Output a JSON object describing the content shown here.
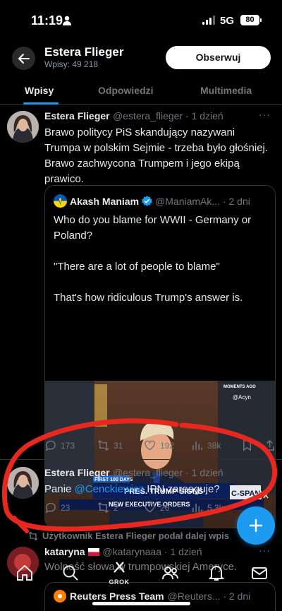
{
  "status_bar": {
    "time": "11:19",
    "network": "5G",
    "battery": "80"
  },
  "profile_header": {
    "name": "Estera Flieger",
    "post_count": "Wpisy: 49 218",
    "follow_label": "Obserwuj"
  },
  "tabs": [
    {
      "label": "Wpisy",
      "active": true
    },
    {
      "label": "Odpowiedzi",
      "active": false
    },
    {
      "label": "Multimedia",
      "active": false
    }
  ],
  "tweets": [
    {
      "name": "Estera Flieger",
      "handle": "@estera_flieger · 1 dzień",
      "text": "Brawo politycy PiS skandujący nazywani Trumpa w polskim Sejmie - trzeba było głośniej. Brawo zachwycona Trumpem i jego ekipą prawico.",
      "quote": {
        "name": "Akash Maniam",
        "handle": "@ManiamAk... · 2 dni",
        "paragraphs": [
          "Who do you blame for WWII - Germany or Poland?",
          "\"There are a lot of people to blame\"",
          "That's how ridiculous Trump's answer is."
        ],
        "media": {
          "badge": "MOMENTS AGO",
          "watermark": "@Acyn",
          "banner_tag": "FIRST 100 DAYS",
          "banner_text": "PRES. TRUMP SIGNS",
          "banner_text_2": "NEW EXECUTIVE ORDERS",
          "channel": "C-SPAN"
        }
      },
      "actions": {
        "replies": "173",
        "retweets": "31",
        "likes": "192",
        "views": "38k"
      }
    },
    {
      "name": "Estera Flieger",
      "handle": "@estera_flieger · 1 dzień",
      "text_prefix": "Panie ",
      "mention": "@Cenckiewicz",
      "text_suffix": " IPN zareaguje?",
      "actions": {
        "replies": "23",
        "retweets": "2",
        "likes": "26",
        "views": "5,3k"
      }
    },
    {
      "retweet_context": "Użytkownik Estera Flieger podał dalej wpis",
      "name": "kataryna",
      "handle": "@katarynaaa · 1 dzień",
      "text": "Wolność słowa w trumpowskiej Ameryce.",
      "quote": {
        "name": "Reuters Press Team",
        "handle": "@Reuters... · 2 dni"
      }
    }
  ],
  "bottom_nav": {
    "grok_label": "GROK"
  },
  "colors": {
    "accent": "#1d9bf0",
    "annotation": "#e8281e",
    "background": "#000000"
  }
}
